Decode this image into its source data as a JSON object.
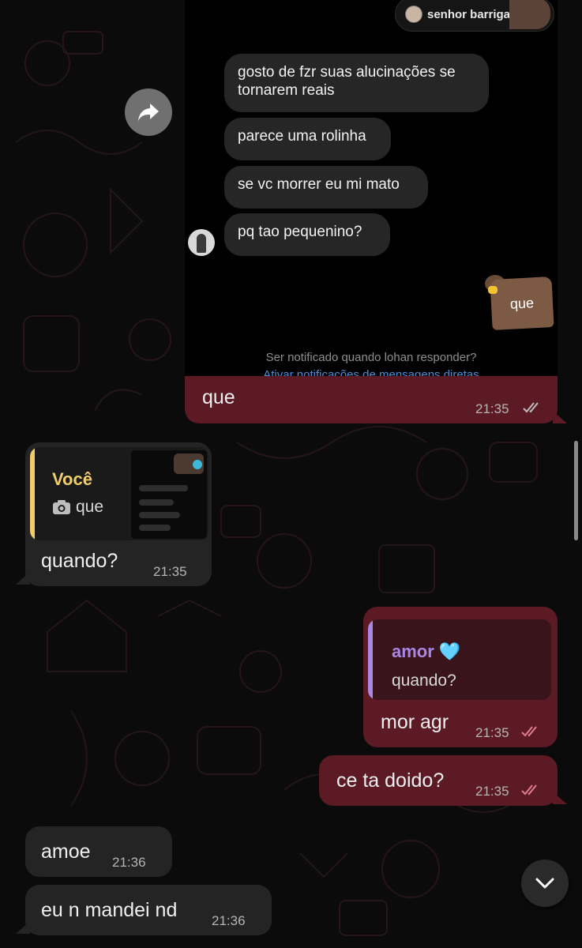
{
  "screenshot": {
    "story_name": "senhor barriga bras...",
    "messages": [
      "gosto de fzr suas alucinações se tornarem reais",
      "parece uma rolinha",
      "se vc morrer eu mi mato",
      "pq tao pequenino?"
    ],
    "sticker_text": "que",
    "notify_text": "Ser notificado quando lohan responder?",
    "notify_link": "Ativar notificações de mensagens diretas"
  },
  "chat": {
    "out1": {
      "text": "que",
      "time": "21:35"
    },
    "in1": {
      "quote_author": "Você",
      "quote_text": "que",
      "text": "quando?",
      "time": "21:35"
    },
    "out2": {
      "quote_author": "amor 🩵",
      "quote_text": "quando?",
      "text": "mor agr",
      "time": "21:35"
    },
    "out3": {
      "text": "ce ta doido?",
      "time": "21:35"
    },
    "in2": {
      "text": "amoe",
      "time": "21:36"
    },
    "in3": {
      "text": "eu n mandei nd",
      "time": "21:36"
    }
  },
  "colors": {
    "outgoing_bubble": "#5c1a25",
    "incoming_bubble": "#242424",
    "read_ticks": "#e07d8c",
    "quote_you": "#f0cd6a",
    "quote_amor": "#a887e6"
  },
  "icons": [
    "forward-icon",
    "camera-icon",
    "double-check-icon",
    "chevron-down-icon"
  ]
}
